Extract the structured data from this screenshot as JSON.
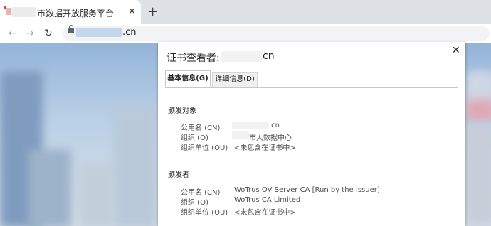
{
  "browser": {
    "tab_title": "市数据开放服务平台",
    "tab_close_glyph": "✕",
    "new_tab_glyph": "+",
    "back_glyph": "←",
    "forward_glyph": "→",
    "reload_glyph": "↻",
    "url_suffix": ".cn"
  },
  "dialog": {
    "title": "证书查看者:",
    "title_suffix": "cn",
    "close_glyph": "✕",
    "tabs": [
      {
        "label": "基本信息(G)"
      },
      {
        "label": "详细信息(D)"
      }
    ],
    "subject": {
      "heading": "颁发对象",
      "rows": [
        {
          "label": "公用名 (CN)",
          "value": ".cn"
        },
        {
          "label": "组织 (O)",
          "value": "市大数据中心"
        },
        {
          "label": "组织单位 (OU)",
          "value": "<未包含在证书中>"
        }
      ]
    },
    "issuer": {
      "heading": "颁发者",
      "rows": [
        {
          "label": "公用名 (CN)",
          "value": "WoTrus OV Server CA  [Run by the Issuer]"
        },
        {
          "label": "组织 (O)",
          "value": "WoTrus CA Limited"
        },
        {
          "label": "组织单位 (OU)",
          "value": "<未包含在证书中>"
        }
      ]
    }
  }
}
